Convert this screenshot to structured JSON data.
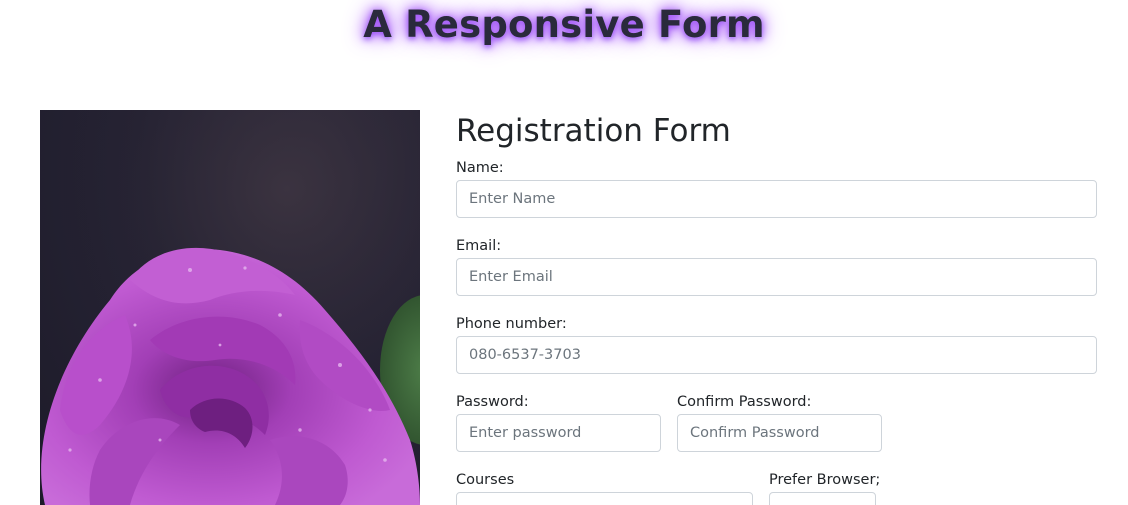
{
  "page": {
    "title": "A Responsive Form"
  },
  "image": {
    "alt": "purple rose",
    "colors": {
      "background": "#1f1d2b",
      "petal": "#b14fc4",
      "petal_dark": "#7a2a8e",
      "leaf": "#3d6b3a"
    }
  },
  "form": {
    "heading": "Registration Form",
    "fields": {
      "name": {
        "label": "Name:",
        "placeholder": "Enter Name",
        "value": ""
      },
      "email": {
        "label": "Email:",
        "placeholder": "Enter Email",
        "value": ""
      },
      "phone": {
        "label": "Phone number:",
        "placeholder": "080-6537-3703",
        "value": ""
      },
      "password": {
        "label": "Password:",
        "placeholder": "Enter password",
        "value": ""
      },
      "confirm_password": {
        "label": "Confirm Password:",
        "placeholder": "Confirm Password",
        "value": ""
      },
      "courses": {
        "label": "Courses",
        "value": ""
      },
      "browser": {
        "label": "Prefer Browser;",
        "value": ""
      }
    }
  }
}
